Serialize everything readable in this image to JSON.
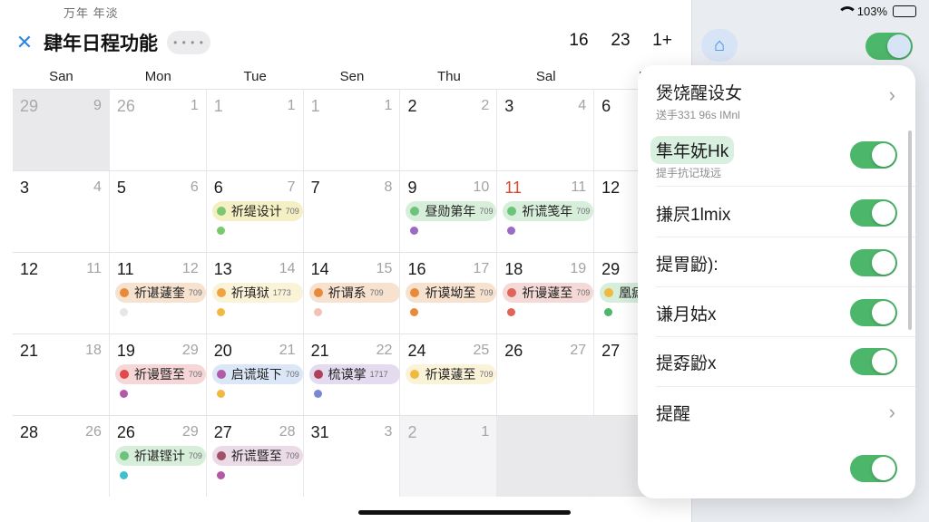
{
  "status": {
    "left_text": "万年 年淡",
    "battery": "103%"
  },
  "header": {
    "title": "肆年日程功能",
    "more": "• • • •",
    "right_items": [
      "16",
      "23",
      "1+"
    ]
  },
  "weekdays": [
    "San",
    "Mon",
    "Tue",
    "Sen",
    "Thu",
    "Sal",
    "F"
  ],
  "weeks": [
    {
      "days": [
        {
          "d": "29",
          "l": "9",
          "dim": true,
          "cls": "shade"
        },
        {
          "d": "26",
          "l": "1",
          "dim": true
        },
        {
          "d": "1",
          "l": "1",
          "dim": true
        },
        {
          "d": "1",
          "l": "1",
          "dim": true
        },
        {
          "d": "2",
          "l": "2"
        },
        {
          "d": "3",
          "l": "4"
        },
        {
          "d": "6",
          "l": ""
        }
      ]
    },
    {
      "days": [
        {
          "d": "3",
          "l": "4"
        },
        {
          "d": "5",
          "l": "6"
        },
        {
          "d": "6",
          "l": "7",
          "ev": {
            "t": "祈缇设计",
            "s": "709",
            "c": "#7bc96f",
            "bg": "#f5efc4"
          },
          "dot": "#7bc96f"
        },
        {
          "d": "7",
          "l": "8"
        },
        {
          "d": "9",
          "l": "10",
          "ev": {
            "t": "昼勋第年",
            "s": "709",
            "c": "#6bc47a",
            "bg": "#d7eedb"
          },
          "dot": "#9b6bc4"
        },
        {
          "d": "11",
          "l": "11",
          "red": true,
          "ev": {
            "t": "祈谎笺年",
            "s": "709",
            "c": "#6bc47a",
            "bg": "#d7eedb"
          },
          "dot": "#9b6bc4"
        },
        {
          "d": "12",
          "l": ""
        }
      ]
    },
    {
      "days": [
        {
          "d": "12",
          "l": "11"
        },
        {
          "d": "11",
          "l": "12",
          "ev": {
            "t": "祈谌蘧奎",
            "s": "709",
            "c": "#e98a3a",
            "bg": "#f7e1cf"
          },
          "dot": "#e6e6e6"
        },
        {
          "d": "13",
          "l": "14",
          "ev": {
            "t": "祈瑱狱",
            "s": "1773",
            "c": "#f0a340",
            "bg": "#faf3d8"
          },
          "dot": "#f0b940"
        },
        {
          "d": "14",
          "l": "15",
          "ev": {
            "t": "祈谓系",
            "s": "709",
            "c": "#e98a3a",
            "bg": "#f7e1cf"
          },
          "dot": "#f2c2b4"
        },
        {
          "d": "16",
          "l": "17",
          "ev": {
            "t": "祈谟坳至",
            "s": "709",
            "c": "#e98a3a",
            "bg": "#f7e1cf"
          },
          "dot": "#e98a3a"
        },
        {
          "d": "18",
          "l": "19",
          "ev": {
            "t": "祈谩蘧至",
            "s": "709",
            "c": "#e0645a",
            "bg": "#f4d9d6"
          },
          "dot": "#e0645a"
        },
        {
          "d": "29",
          "l": "",
          "ev": {
            "t": "凰瘧",
            "s": "",
            "c": "#f0b940",
            "bg": "#d7eedb"
          },
          "dot": "#4cb66a"
        }
      ]
    },
    {
      "days": [
        {
          "d": "21",
          "l": "18"
        },
        {
          "d": "19",
          "l": "29",
          "ev": {
            "t": "祈谩暨至",
            "s": "709",
            "c": "#e04a4a",
            "bg": "#f6d6d6"
          },
          "dot": "#b05aa8"
        },
        {
          "d": "20",
          "l": "21",
          "ev": {
            "t": "启谎埏下",
            "s": "709",
            "c": "#b05aa8",
            "bg": "#dbe6f6"
          },
          "dot": "#f0b940"
        },
        {
          "d": "21",
          "l": "22",
          "ev": {
            "t": "梳谟掌",
            "s": "1717",
            "c": "#b0405a",
            "bg": "#e4dbef"
          },
          "dot": "#7a86d6"
        },
        {
          "d": "24",
          "l": "25",
          "ev": {
            "t": "祈谟蘧至",
            "s": "709",
            "c": "#f0b940",
            "bg": "#faf3d8"
          }
        },
        {
          "d": "26",
          "l": "27"
        },
        {
          "d": "27",
          "l": ""
        }
      ]
    },
    {
      "days": [
        {
          "d": "28",
          "l": "26"
        },
        {
          "d": "26",
          "l": "29",
          "ev": {
            "t": "祈谌铿计",
            "s": "709",
            "c": "#6bc47a",
            "bg": "#d7eedb"
          },
          "dot": "#3fbfd0"
        },
        {
          "d": "27",
          "l": "28",
          "ev": {
            "t": "祈谎暨至",
            "s": "709",
            "c": "#a0506a",
            "bg": "#eadbe6"
          },
          "dot": "#b05aa8"
        },
        {
          "d": "31",
          "l": "3"
        },
        {
          "d": "2",
          "l": "1",
          "dim": true,
          "cls": "muted"
        },
        {
          "d": "",
          "l": "",
          "cls": "shade"
        },
        {
          "d": "",
          "l": "",
          "cls": "shade"
        }
      ]
    }
  ],
  "sheet": {
    "row1": {
      "label": "煲饶醒设女",
      "sub": "送手331 96s IMnl"
    },
    "row2": {
      "label": "隼年妩Hk",
      "sub": "提手抗记珑远"
    },
    "row3": {
      "label": "搛屄1lmix"
    },
    "row4": {
      "label": "提胃鼢):"
    },
    "row5": {
      "label": "谦月姑x"
    },
    "row6": {
      "label": "提孬鼢x"
    },
    "row7": {
      "label": "提醒"
    }
  },
  "colors": {
    "accent": "#2f86e6",
    "toggle_on": "#4cb66a"
  }
}
